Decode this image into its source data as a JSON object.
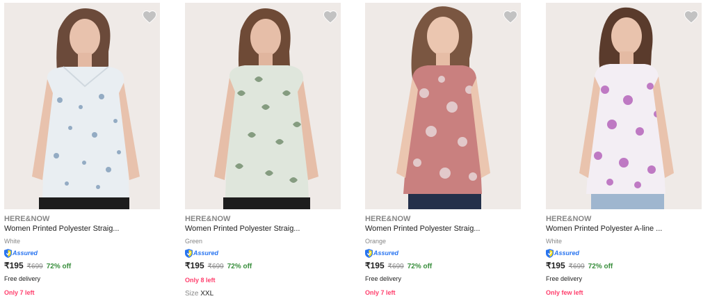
{
  "products": [
    {
      "brand": "HERE&NOW",
      "title": "Women Printed Polyester Straig...",
      "color": "White",
      "assured": "Assured",
      "price": "₹195",
      "mrp": "₹699",
      "discount": "72% off",
      "delivery": "Free delivery",
      "stock": "Only 7 left",
      "top_color": "#e9eef2",
      "print_color": "#6f8fb0"
    },
    {
      "brand": "HERE&NOW",
      "title": "Women Printed Polyester Straig...",
      "color": "Green",
      "assured": "Assured",
      "price": "₹195",
      "mrp": "₹699",
      "discount": "72% off",
      "stock": "Only 8 left",
      "size_label": "Size",
      "size_value": "XXL",
      "top_color": "#dfe6dc",
      "print_color": "#6f8a6a"
    },
    {
      "brand": "HERE&NOW",
      "title": "Women Printed Polyester Straig...",
      "color": "Orange",
      "assured": "Assured",
      "price": "₹195",
      "mrp": "₹699",
      "discount": "72% off",
      "delivery": "Free delivery",
      "stock": "Only 7 left",
      "top_color": "#c9807f",
      "print_color": "#e7d6d8"
    },
    {
      "brand": "HERE&NOW",
      "title": "Women Printed Polyester A-line ...",
      "color": "White",
      "assured": "Assured",
      "price": "₹195",
      "mrp": "₹699",
      "discount": "72% off",
      "delivery": "Free delivery",
      "stock": "Only few left",
      "top_color": "#f3eef4",
      "print_color": "#b25cb8"
    }
  ],
  "icons": {
    "wishlist": "heart-icon",
    "assured": "shield-icon"
  },
  "colors": {
    "price_green": "#388e3c",
    "stock_pink": "#ff3e6c",
    "assured_blue": "#2874f0",
    "muted": "#878787"
  }
}
